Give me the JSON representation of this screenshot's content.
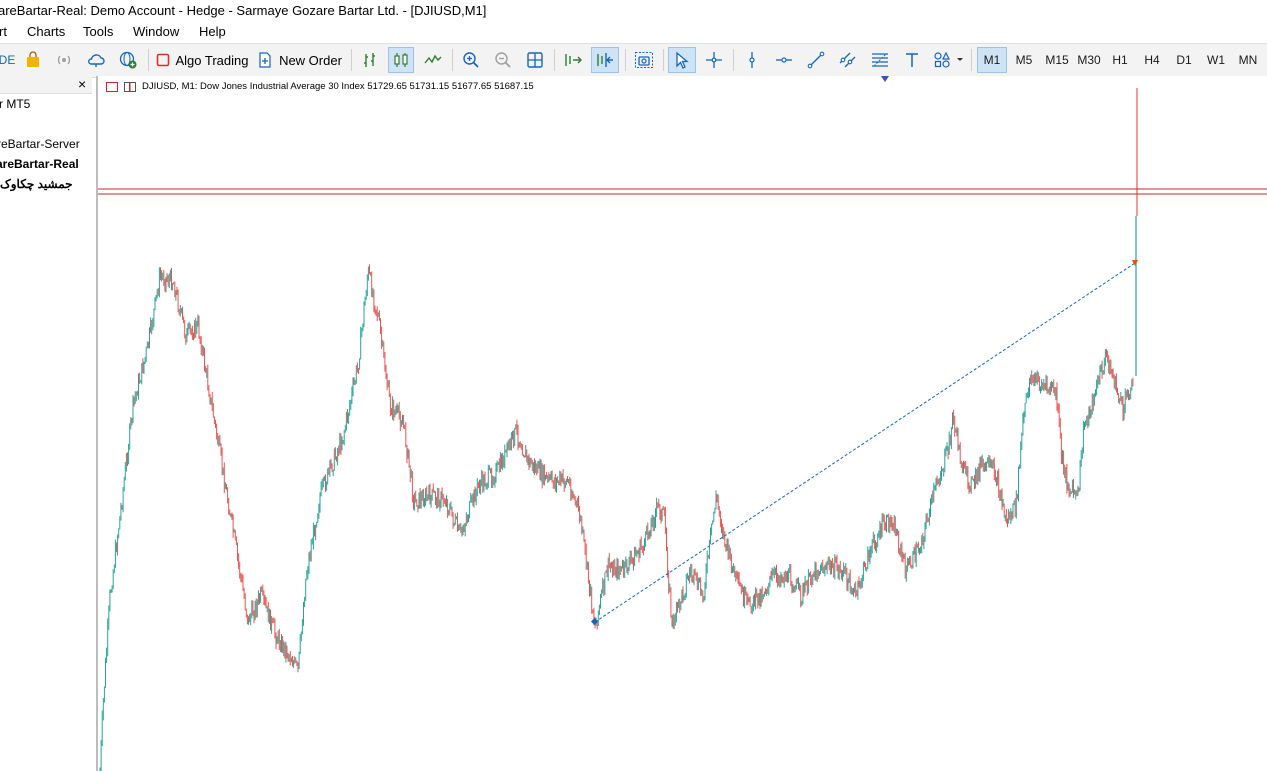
{
  "window": {
    "title": "areBartar-Real: Demo Account - Hedge - Sarmaye Gozare Bartar Ltd. - [DJIUSD,M1]"
  },
  "menu": {
    "items": [
      "rt",
      "Charts",
      "Tools",
      "Window",
      "Help"
    ]
  },
  "toolbar": {
    "partial_left_label": "DE",
    "algo_trading_label": "Algo Trading",
    "new_order_label": "New Order",
    "timeframes": [
      "M1",
      "M5",
      "M15",
      "M30",
      "H1",
      "H4",
      "D1",
      "W1",
      "MN"
    ],
    "selected_timeframe": "M1"
  },
  "navigator": {
    "header_close": "×",
    "items": [
      {
        "label": "r MT5",
        "bold": false
      },
      {
        "label": "reBartar-Server",
        "bold": false
      },
      {
        "label": "areBartar-Real",
        "bold": true
      },
      {
        "label": "جمشید چکاوک",
        "bold": true
      }
    ]
  },
  "chart": {
    "info_line": "DJIUSD, M1:  Dow Jones Industrial Average 30 Index  51729.65 51731.15 51677.65 51687.15",
    "symbol": "DJIUSD",
    "timeframe": "M1",
    "description": "Dow Jones Industrial Average 30 Index",
    "ohlc": {
      "open": 51729.65,
      "high": 51731.15,
      "low": 51677.65,
      "close": 51687.15
    },
    "colors": {
      "bull": "#26a69a",
      "bear": "#ef5350",
      "hline": "#c62828",
      "trendline": "#1565c0",
      "grid": "none"
    }
  }
}
